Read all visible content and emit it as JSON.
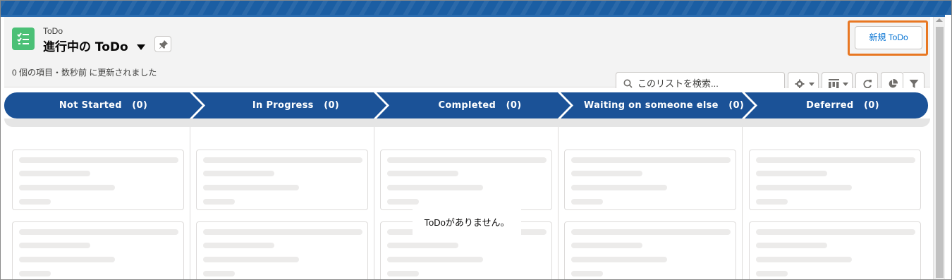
{
  "header": {
    "object_type": "ToDo",
    "list_view_name": "進行中の ToDo",
    "status": "0 個の項目・数秒前 に更新されました",
    "new_button_label": "新規 ToDo"
  },
  "search": {
    "placeholder": "このリストを検索..."
  },
  "toolbar": {
    "icons": [
      "gear-icon",
      "kanban-view-icon",
      "refresh-icon",
      "chart-icon",
      "filter-icon"
    ]
  },
  "stages": [
    {
      "label": "Not Started",
      "count": "(0)"
    },
    {
      "label": "In Progress",
      "count": "(0)"
    },
    {
      "label": "Completed",
      "count": "(0)"
    },
    {
      "label": "Waiting on someone else",
      "count": "(0)"
    },
    {
      "label": "Deferred",
      "count": "(0)"
    }
  ],
  "empty_message": "ToDoがありません。",
  "colors": {
    "stage_blue": "#1b5297",
    "highlight_orange": "#e87722",
    "object_icon_green": "#4bc076",
    "link_blue": "#0070d2"
  }
}
